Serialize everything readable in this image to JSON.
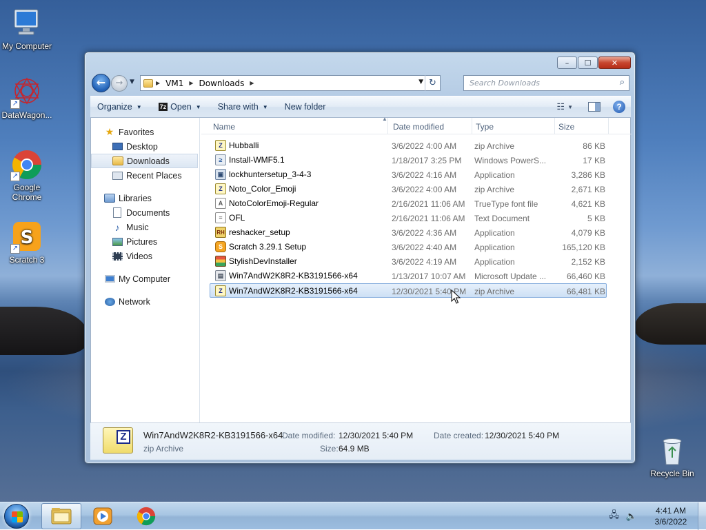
{
  "desktop": {
    "icons": [
      {
        "label": "My Computer"
      },
      {
        "label": "DataWagon..."
      },
      {
        "label": "Google Chrome"
      },
      {
        "label": "Scratch 3"
      },
      {
        "label": "Recycle Bin"
      }
    ]
  },
  "window": {
    "controls": {
      "minimize": "–",
      "maximize": "☐",
      "close": "✕"
    },
    "address": {
      "segments": [
        "VM1",
        "Downloads"
      ]
    },
    "search": {
      "placeholder": "Search Downloads"
    },
    "toolbar": {
      "organize": "Organize",
      "open_badge": "7z",
      "open": "Open",
      "share_with": "Share with",
      "new_folder": "New folder"
    },
    "nav": {
      "favorites": "Favorites",
      "desktop": "Desktop",
      "downloads": "Downloads",
      "recent_places": "Recent Places",
      "libraries": "Libraries",
      "documents": "Documents",
      "music": "Music",
      "pictures": "Pictures",
      "videos": "Videos",
      "my_computer": "My Computer",
      "network": "Network"
    },
    "columns": {
      "name": "Name",
      "date": "Date modified",
      "type": "Type",
      "size": "Size"
    },
    "files": [
      {
        "name": "Hubballi",
        "date": "3/6/2022 4:00 AM",
        "type": "zip Archive",
        "size": "86 KB",
        "icon": "zip-icon",
        "glyph": "Z"
      },
      {
        "name": "Install-WMF5.1",
        "date": "1/18/2017 3:25 PM",
        "type": "Windows PowerS...",
        "size": "17 KB",
        "icon": "powershell-script-icon",
        "glyph": "≥"
      },
      {
        "name": "lockhuntersetup_3-4-3",
        "date": "3/6/2022 4:16 AM",
        "type": "Application",
        "size": "3,286 KB",
        "icon": "application-icon",
        "glyph": "▣"
      },
      {
        "name": "Noto_Color_Emoji",
        "date": "3/6/2022 4:00 AM",
        "type": "zip Archive",
        "size": "2,671 KB",
        "icon": "zip-icon",
        "glyph": "Z"
      },
      {
        "name": "NotoColorEmoji-Regular",
        "date": "2/16/2021 11:06 AM",
        "type": "TrueType font file",
        "size": "4,621 KB",
        "icon": "font-file-icon",
        "glyph": "A"
      },
      {
        "name": "OFL",
        "date": "2/16/2021 11:06 AM",
        "type": "Text Document",
        "size": "5 KB",
        "icon": "text-document-icon",
        "glyph": "≡"
      },
      {
        "name": "reshacker_setup",
        "date": "3/6/2022 4:36 AM",
        "type": "Application",
        "size": "4,079 KB",
        "icon": "reshacker-icon",
        "glyph": "RH"
      },
      {
        "name": "Scratch 3.29.1 Setup",
        "date": "3/6/2022 4:40 AM",
        "type": "Application",
        "size": "165,120 KB",
        "icon": "scratch-icon",
        "glyph": "S"
      },
      {
        "name": "StylishDevInstaller",
        "date": "3/6/2022 4:19 AM",
        "type": "Application",
        "size": "2,152 KB",
        "icon": "installer-icon",
        "glyph": ""
      },
      {
        "name": "Win7AndW2K8R2-KB3191566-x64",
        "date": "1/13/2017 10:07 AM",
        "type": "Microsoft Update ...",
        "size": "66,460 KB",
        "icon": "update-package-icon",
        "glyph": "▤"
      },
      {
        "name": "Win7AndW2K8R2-KB3191566-x64",
        "date": "12/30/2021 5:40 PM",
        "type": "zip Archive",
        "size": "66,481 KB",
        "icon": "zip-icon",
        "glyph": "Z",
        "selected": true
      }
    ],
    "details": {
      "name": "Win7AndW2K8R2-KB3191566-x64",
      "type": "zip Archive",
      "modified_label": "Date modified:",
      "modified": "12/30/2021 5:40 PM",
      "created_label": "Date created:",
      "created": "12/30/2021 5:40 PM",
      "size_label": "Size:",
      "size": "64.9 MB"
    }
  },
  "taskbar": {
    "clock": {
      "time": "4:41 AM",
      "date": "3/6/2022"
    }
  }
}
